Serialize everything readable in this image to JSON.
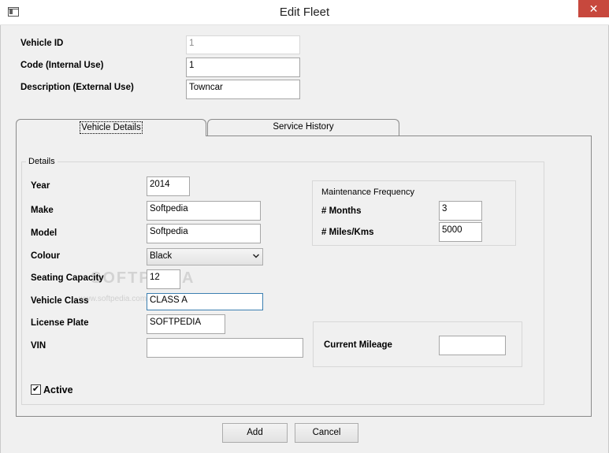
{
  "window": {
    "title": "Edit Fleet",
    "close_glyph": "✕",
    "app_icon": "app-window-icon",
    "close_icon": "close-icon"
  },
  "header_fields": {
    "vehicle_id": {
      "label": "Vehicle ID",
      "value": "1"
    },
    "code": {
      "label": "Code (Internal Use)",
      "value": "1"
    },
    "description": {
      "label": "Description (External Use)",
      "value": "Towncar"
    }
  },
  "tabs": [
    {
      "label": "Vehicle Details",
      "selected": true
    },
    {
      "label": "Service History",
      "selected": false
    }
  ],
  "details": {
    "group_title": "Details",
    "year": {
      "label": "Year",
      "value": "2014"
    },
    "make": {
      "label": "Make",
      "value": "Softpedia"
    },
    "model": {
      "label": "Model",
      "value": "Softpedia"
    },
    "colour": {
      "label": "Colour",
      "value": "Black"
    },
    "seating": {
      "label": "Seating Capacity",
      "value": "12"
    },
    "vehicle_class": {
      "label": "Vehicle Class",
      "value": "CLASS A"
    },
    "license_plate": {
      "label": "License Plate",
      "value": "SOFTPEDIA"
    },
    "vin": {
      "label": "VIN",
      "value": ""
    },
    "active": {
      "label": "Active",
      "checked": true,
      "glyph": "✔"
    }
  },
  "maintenance": {
    "title": "Maintenance Frequency",
    "months": {
      "label": "# Months",
      "value": "3"
    },
    "miles": {
      "label": "# Miles/Kms",
      "value": "5000"
    }
  },
  "mileage": {
    "label": "Current Mileage",
    "value": ""
  },
  "buttons": {
    "add": "Add",
    "cancel": "Cancel"
  },
  "watermark": {
    "brand": "SOFTPEDIA",
    "url": "www.softpedia.com"
  },
  "colors": {
    "close_button": "#c7483d",
    "focus_border": "#3c7fb1"
  }
}
